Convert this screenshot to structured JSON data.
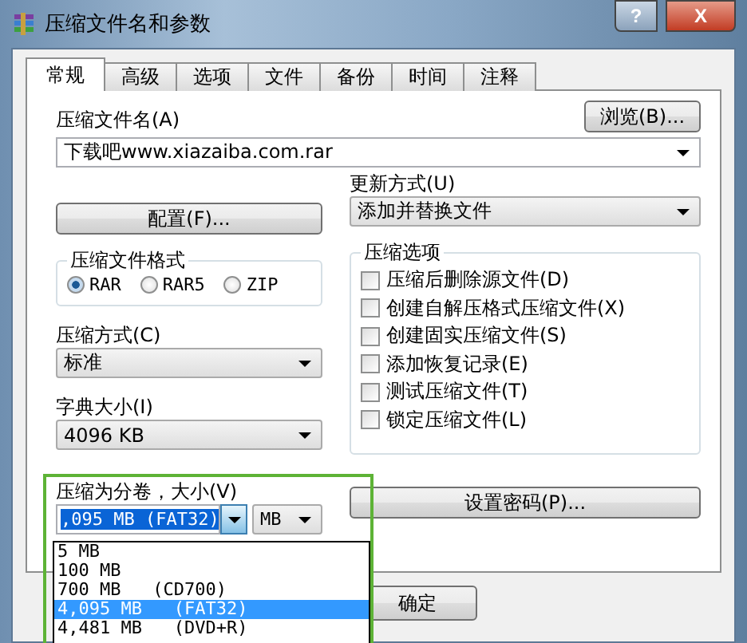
{
  "window": {
    "title": "压缩文件名和参数",
    "help_button": "?",
    "close_button": "X"
  },
  "tabs": [
    {
      "label": "常规",
      "selected": true
    },
    {
      "label": "高级",
      "selected": false
    },
    {
      "label": "选项",
      "selected": false
    },
    {
      "label": "文件",
      "selected": false
    },
    {
      "label": "备份",
      "selected": false
    },
    {
      "label": "时间",
      "selected": false
    },
    {
      "label": "注释",
      "selected": false
    }
  ],
  "archive_name": {
    "label": "压缩文件名(A)",
    "value": "下载吧www.xiazaiba.com.rar"
  },
  "browse_button": "浏览(B)...",
  "update_mode": {
    "label": "更新方式(U)",
    "value": "添加并替换文件"
  },
  "profiles_button": "配置(F)...",
  "archive_format": {
    "title": "压缩文件格式",
    "options": [
      {
        "label": "RAR",
        "selected": true
      },
      {
        "label": "RAR5",
        "selected": false
      },
      {
        "label": "ZIP",
        "selected": false
      }
    ]
  },
  "compression_options": {
    "title": "压缩选项",
    "items": [
      {
        "label": "压缩后删除源文件(D)",
        "checked": false
      },
      {
        "label": "创建自解压格式压缩文件(X)",
        "checked": false
      },
      {
        "label": "创建固实压缩文件(S)",
        "checked": false
      },
      {
        "label": "添加恢复记录(E)",
        "checked": false
      },
      {
        "label": "测试压缩文件(T)",
        "checked": false
      },
      {
        "label": "锁定压缩文件(L)",
        "checked": false
      }
    ]
  },
  "compression_method": {
    "label": "压缩方式(C)",
    "value": "标准"
  },
  "dictionary_size": {
    "label": "字典大小(I)",
    "value": "4096 KB"
  },
  "split_volumes": {
    "label": "压缩为分卷，大小(V)",
    "value": ",095 MB   (FAT32)",
    "unit": "MB",
    "options": [
      {
        "label": "5 MB",
        "selected": false
      },
      {
        "label": "100 MB",
        "selected": false
      },
      {
        "label": "700 MB   (CD700)",
        "selected": false
      },
      {
        "label": "4,095 MB   (FAT32)",
        "selected": true
      },
      {
        "label": "4,481 MB   (DVD+R)",
        "selected": false
      }
    ]
  },
  "set_password_button": "设置密码(P)...",
  "ok_button": "确定"
}
